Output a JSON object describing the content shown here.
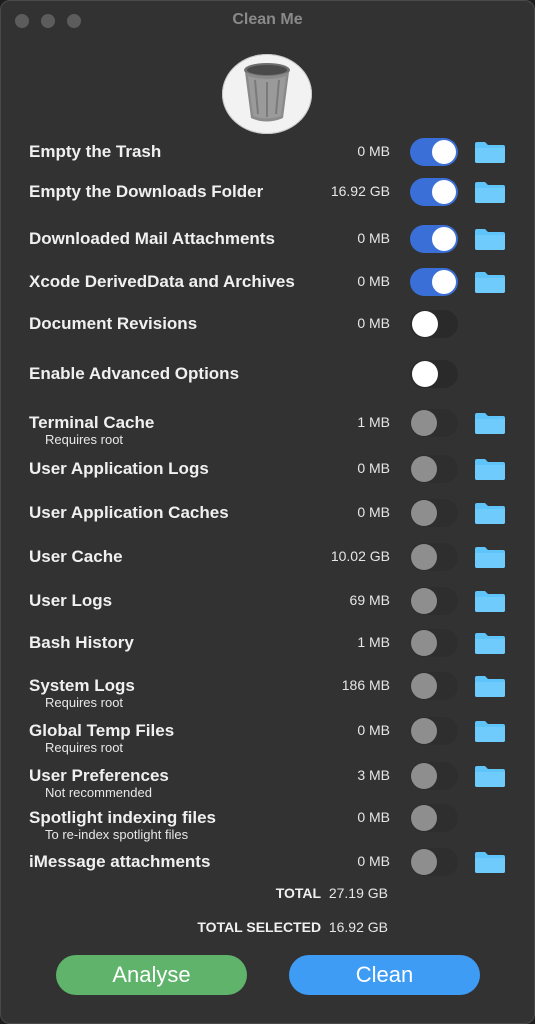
{
  "window": {
    "title": "Clean Me"
  },
  "items": [
    {
      "label": "Empty the Trash",
      "sub": "",
      "size": "0 MB",
      "state": "on",
      "folder": true
    },
    {
      "label": "Empty the Downloads Folder",
      "sub": "",
      "size": "16.92 GB",
      "state": "on",
      "folder": true
    },
    {
      "label": "Downloaded Mail Attachments",
      "sub": "",
      "size": "0 MB",
      "state": "on",
      "folder": true
    },
    {
      "label": "Xcode DerivedData and Archives",
      "sub": "",
      "size": "0 MB",
      "state": "on",
      "folder": true
    },
    {
      "label": "Document Revisions",
      "sub": "",
      "size": "0 MB",
      "state": "off",
      "folder": false
    },
    {
      "label": "Enable Advanced Options",
      "sub": "",
      "size": "",
      "state": "off",
      "folder": false
    },
    {
      "label": "Terminal Cache",
      "sub": "Requires root",
      "size": "1 MB",
      "state": "disabled",
      "folder": true
    },
    {
      "label": "User Application Logs",
      "sub": "",
      "size": "0 MB",
      "state": "disabled",
      "folder": true
    },
    {
      "label": "User Application Caches",
      "sub": "",
      "size": "0 MB",
      "state": "disabled",
      "folder": true
    },
    {
      "label": "User Cache",
      "sub": "",
      "size": "10.02 GB",
      "state": "disabled",
      "folder": true
    },
    {
      "label": "User Logs",
      "sub": "",
      "size": "69 MB",
      "state": "disabled",
      "folder": true
    },
    {
      "label": "Bash History",
      "sub": "",
      "size": "1 MB",
      "state": "disabled",
      "folder": true
    },
    {
      "label": "System Logs",
      "sub": "Requires root",
      "size": "186 MB",
      "state": "disabled",
      "folder": true
    },
    {
      "label": "Global Temp Files",
      "sub": "Requires root",
      "size": "0 MB",
      "state": "disabled",
      "folder": true
    },
    {
      "label": "User Preferences",
      "sub": "Not recommended",
      "size": "3 MB",
      "state": "disabled",
      "folder": true
    },
    {
      "label": "Spotlight indexing files",
      "sub": "To re-index spotlight files",
      "size": "0 MB",
      "state": "disabled",
      "folder": false
    },
    {
      "label": "iMessage attachments",
      "sub": "",
      "size": "0 MB",
      "state": "disabled",
      "folder": true
    }
  ],
  "totals": {
    "total_label": "TOTAL",
    "total_value": "27.19 GB",
    "selected_label": "TOTAL SELECTED",
    "selected_value": "16.92 GB"
  },
  "buttons": {
    "analyse": "Analyse",
    "clean": "Clean"
  },
  "colors": {
    "toggle_on": "#3a6fd8",
    "folder": "#5ec4fa",
    "analyse": "#5fb36a",
    "clean": "#3f9cf5"
  }
}
